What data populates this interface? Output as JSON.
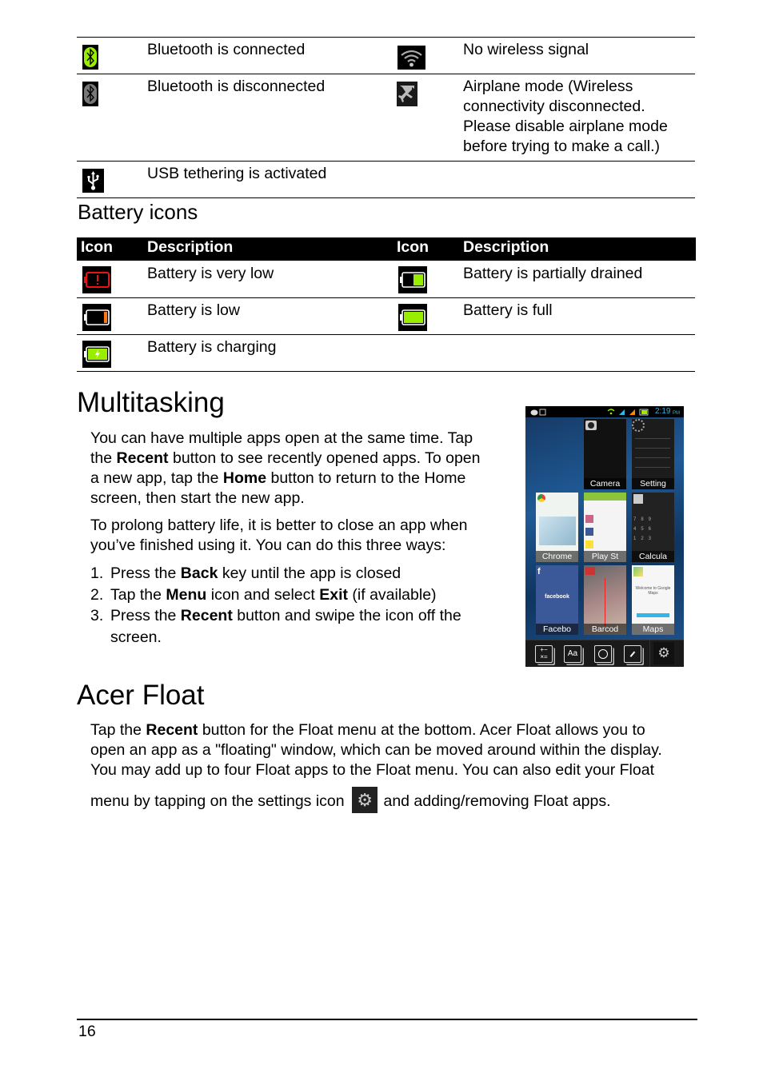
{
  "connectivity_table": {
    "rows": [
      {
        "left": {
          "icon": "bluetooth-connected-icon",
          "description": "Bluetooth is connected"
        },
        "right": {
          "icon": "no-wireless-signal-icon",
          "description": "No wireless signal"
        }
      },
      {
        "left": {
          "icon": "bluetooth-disconnected-icon",
          "description": "Bluetooth is disconnected"
        },
        "right": {
          "icon": "airplane-mode-icon",
          "description_lines": [
            "Airplane mode (Wireless",
            "connectivity disconnected.",
            "Please disable airplane mode",
            "before trying to make a call.)"
          ]
        }
      },
      {
        "left": {
          "icon": "usb-tethering-icon",
          "description": "USB tethering is activated"
        },
        "right": null
      }
    ]
  },
  "battery_section": {
    "heading": "Battery icons",
    "header": {
      "icon_col": "Icon",
      "desc_col": "Description"
    },
    "rows": [
      {
        "left": {
          "icon": "battery-very-low-icon",
          "description": "Battery is very low"
        },
        "right": {
          "icon": "battery-partially-drained-icon",
          "description": "Battery is partially drained"
        }
      },
      {
        "left": {
          "icon": "battery-low-icon",
          "description": "Battery is low"
        },
        "right": {
          "icon": "battery-full-icon",
          "description": "Battery is full"
        }
      },
      {
        "left": {
          "icon": "battery-charging-icon",
          "description": "Battery is charging"
        },
        "right": null
      }
    ],
    "colors": {
      "green": "#99ee00",
      "red": "#ee1111",
      "orange": "#ff7711"
    }
  },
  "multitasking": {
    "heading": "Multitasking",
    "para1": {
      "t1": "You can have multiple apps open at the same time. Tap",
      "t2a": "the ",
      "t2b": "Recent",
      "t2c": " button to see recently opened apps. To open",
      "t3a": "a new app, tap the ",
      "t3b": "Home",
      "t3c": " button to return to the Home",
      "t4": "screen, then start the new app."
    },
    "para2": {
      "t1": "To prolong battery life, it is better to close an app when",
      "t2": "you’ve finished using it. You can do this three ways:"
    },
    "steps": [
      {
        "num": "1.",
        "a": "Press the ",
        "b": "Back",
        "c": " key until the app is closed"
      },
      {
        "num": "2.",
        "a": "Tap the ",
        "b": "Menu",
        "c": " icon and select ",
        "d": "Exit",
        "e": " (if available)"
      },
      {
        "num": "3.",
        "a": "Press the ",
        "b": "Recent",
        "c": " button and swipe the icon off the",
        "line2": "screen."
      }
    ],
    "screenshot": {
      "status_time": "2:19",
      "status_ampm": "PM",
      "recent_apps": [
        "Camera",
        "Settings",
        "Chrome",
        "Play Store",
        "Calculator",
        "Facebook",
        "Barcode",
        "Maps"
      ],
      "recent_app_labels_visible": [
        "Camera",
        "Setting",
        "Chrome",
        "Play St",
        "Calcula",
        "Facebo",
        "Barcod",
        "Maps"
      ],
      "facebook_text": "facebook",
      "maps_text": "Welcome to Google Maps",
      "float_menu": [
        "calculator-float-icon",
        "note-float-icon",
        "camera-float-icon",
        "clock-float-icon",
        "settings-icon"
      ],
      "float_labels": {
        "calc": "+−\n×=",
        "note": "Aa"
      }
    }
  },
  "acer_float": {
    "heading": "Acer Float",
    "l1a": "Tap the ",
    "l1b": "Recent",
    "l1c": " button for the Float menu at the bottom. Acer Float allows you to",
    "l2": "open an app as a \"floating\" window, which can be moved around within the display.",
    "l3": "You may add up to four Float apps to the Float menu. You can also edit your Float",
    "l4a": "menu by tapping on the settings icon",
    "l4b": "and adding/removing Float apps."
  },
  "footer": {
    "page_number": "16"
  }
}
